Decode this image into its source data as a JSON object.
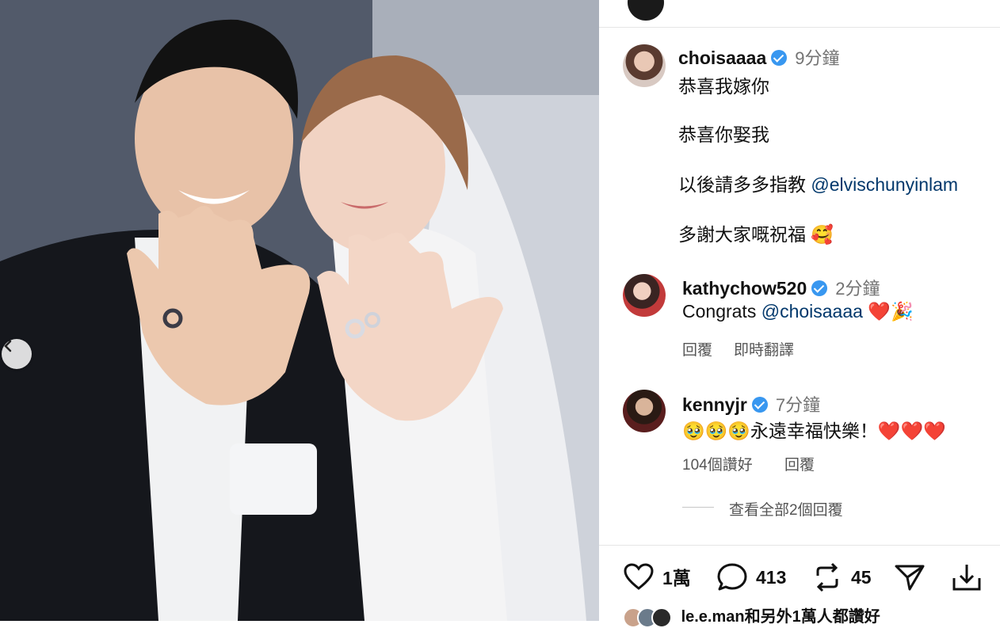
{
  "post": {
    "author": "choisaaaa",
    "time": "9分鐘",
    "caption_lines": [
      "恭喜我嫁你",
      "恭喜你娶我",
      "以後請多多指教",
      "多謝大家嘅祝福"
    ],
    "caption_mention": "@elvischunyinlam",
    "caption_emoji": "🥰"
  },
  "comments": [
    {
      "user": "kathychow520",
      "time": "2分鐘",
      "text": "Congrats",
      "mention": "@choisaaaa",
      "emoji": "❤️🎉",
      "reply_label": "回覆",
      "translate_label": "即時翻譯"
    },
    {
      "user": "kennyjr",
      "time": "7分鐘",
      "emoji_lead": "🥹🥹🥹",
      "text": "永遠幸福快樂！",
      "emoji_tail": "❤️❤️❤️",
      "likes_label": "104個讚好",
      "reply_label": "回覆",
      "view_replies": "查看全部2個回覆"
    }
  ],
  "actions": {
    "likes": "1萬",
    "comments": "413",
    "reposts": "45"
  },
  "liked_by": "le.e.man和另外1萬人都讚好",
  "colors": {
    "verified": "#3897f0",
    "mention": "#00376b",
    "meta": "#555555"
  }
}
